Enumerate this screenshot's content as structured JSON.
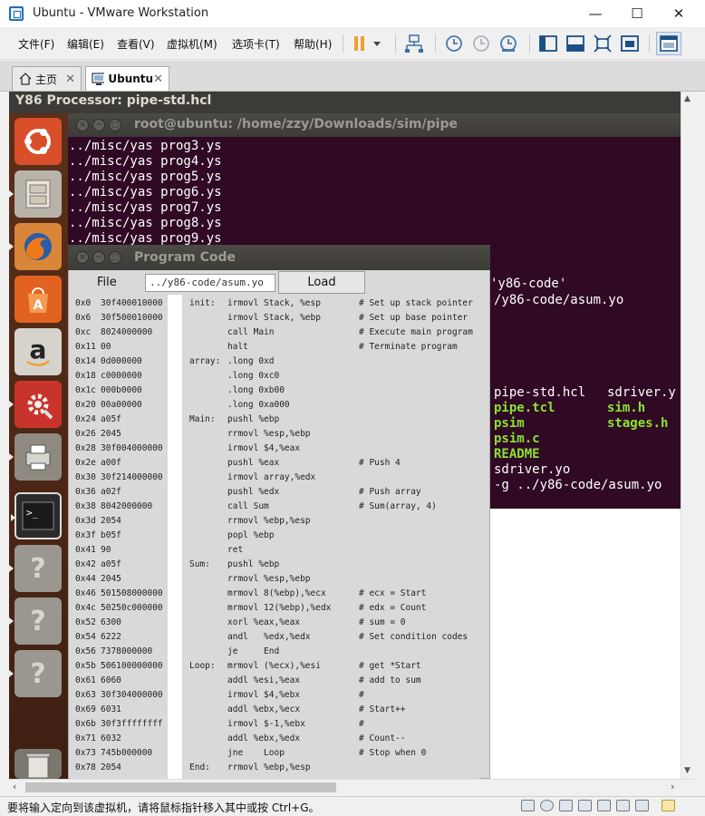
{
  "window": {
    "title": "Ubuntu - VMware Workstation",
    "minimize": "—",
    "maximize": "☐",
    "close": "✕"
  },
  "menu": [
    "文件(F)",
    "编辑(E)",
    "查看(V)",
    "虚拟机(M)",
    "选项卡(T)",
    "帮助(H)"
  ],
  "tabs": [
    {
      "label": "主页",
      "icon": "home-icon"
    },
    {
      "label": "Ubuntu",
      "icon": "vm-icon"
    }
  ],
  "guest": {
    "top_title": "Y86 Processor: pipe-std.hcl",
    "launcher": [
      "ubuntu-dash-icon",
      "files-icon",
      "firefox-icon",
      "software-center-icon",
      "amazon-icon",
      "system-settings-icon",
      "printer-icon",
      "terminal-icon",
      "unknown-app-icon",
      "unknown-app-icon",
      "unknown-app-icon",
      "trash-icon"
    ]
  },
  "terminal": {
    "title": "root@ubuntu: /home/zzy/Downloads/sim/pipe",
    "lines": [
      "../misc/yas prog3.ys",
      "../misc/yas prog4.ys",
      "../misc/yas prog5.ys",
      "../misc/yas prog6.ys",
      "../misc/yas prog7.ys",
      "../misc/yas prog8.ys",
      "../misc/yas prog9.ys"
    ],
    "right_fragments": {
      "r1": "'y86-code'",
      "r2": "/y86-code/asum.yo",
      "r3a": "pipe-std.hcl",
      "r3b": "sdriver.y",
      "r4a": "pipe.tcl",
      "r4b": "sim.h",
      "r5a": "psim",
      "r5b": "stages.h",
      "r6": "psim.c",
      "r7": "README",
      "r8": "sdriver.yo",
      "r9": "-g ../y86-code/asum.yo"
    }
  },
  "program_code": {
    "title": "Program Code",
    "file_label": "File",
    "file_value": "../y86-code/asum.yo",
    "load_label": "Load",
    "rows": [
      {
        "addr": "0x0",
        "code": "30f400010000",
        "label": "init:",
        "instr": "irmovl Stack, %esp",
        "comment": "# Set up stack pointer"
      },
      {
        "addr": "0x6",
        "code": "30f500010000",
        "label": "",
        "instr": "irmovl Stack, %ebp",
        "comment": "# Set up base pointer"
      },
      {
        "addr": "0xc",
        "code": "8024000000",
        "label": "",
        "instr": "call Main",
        "comment": "# Execute main program"
      },
      {
        "addr": "0x11",
        "code": "00",
        "label": "",
        "instr": "halt",
        "comment": "# Terminate program"
      },
      {
        "addr": "0x14",
        "code": "0d000000",
        "label": "array:",
        "instr": ".long 0xd",
        "comment": ""
      },
      {
        "addr": "0x18",
        "code": "c0000000",
        "label": "",
        "instr": ".long 0xc0",
        "comment": ""
      },
      {
        "addr": "0x1c",
        "code": "000b0000",
        "label": "",
        "instr": ".long 0xb00",
        "comment": ""
      },
      {
        "addr": "0x20",
        "code": "00a00000",
        "label": "",
        "instr": ".long 0xa000",
        "comment": ""
      },
      {
        "addr": "0x24",
        "code": "a05f",
        "label": "Main:",
        "instr": "pushl %ebp",
        "comment": ""
      },
      {
        "addr": "0x26",
        "code": "2045",
        "label": "",
        "instr": "rrmovl %esp,%ebp",
        "comment": ""
      },
      {
        "addr": "0x28",
        "code": "30f004000000",
        "label": "",
        "instr": "irmovl $4,%eax",
        "comment": ""
      },
      {
        "addr": "0x2e",
        "code": "a00f",
        "label": "",
        "instr": "pushl %eax",
        "comment": "# Push 4"
      },
      {
        "addr": "0x30",
        "code": "30f214000000",
        "label": "",
        "instr": "irmovl array,%edx",
        "comment": ""
      },
      {
        "addr": "0x36",
        "code": "a02f",
        "label": "",
        "instr": "pushl %edx",
        "comment": "# Push array"
      },
      {
        "addr": "0x38",
        "code": "8042000000",
        "label": "",
        "instr": "call Sum",
        "comment": "# Sum(array, 4)"
      },
      {
        "addr": "0x3d",
        "code": "2054",
        "label": "",
        "instr": "rrmovl %ebp,%esp",
        "comment": ""
      },
      {
        "addr": "0x3f",
        "code": "b05f",
        "label": "",
        "instr": "popl %ebp",
        "comment": ""
      },
      {
        "addr": "0x41",
        "code": "90",
        "label": "",
        "instr": "ret",
        "comment": ""
      },
      {
        "addr": "0x42",
        "code": "a05f",
        "label": "Sum:",
        "instr": "pushl %ebp",
        "comment": ""
      },
      {
        "addr": "0x44",
        "code": "2045",
        "label": "",
        "instr": "rrmovl %esp,%ebp",
        "comment": ""
      },
      {
        "addr": "0x46",
        "code": "501508000000",
        "label": "",
        "instr": "mrmovl 8(%ebp),%ecx",
        "comment": "# ecx = Start"
      },
      {
        "addr": "0x4c",
        "code": "50250c000000",
        "label": "",
        "instr": "mrmovl 12(%ebp),%edx",
        "comment": "# edx = Count"
      },
      {
        "addr": "0x52",
        "code": "6300",
        "label": "",
        "instr": "xorl %eax,%eax",
        "comment": "# sum = 0"
      },
      {
        "addr": "0x54",
        "code": "6222",
        "label": "",
        "instr": "andl   %edx,%edx",
        "comment": "# Set condition codes"
      },
      {
        "addr": "0x56",
        "code": "7378000000",
        "label": "",
        "instr": "je     End",
        "comment": ""
      },
      {
        "addr": "0x5b",
        "code": "506100000000",
        "label": "Loop:",
        "instr": "mrmovl (%ecx),%esi",
        "comment": "# get *Start"
      },
      {
        "addr": "0x61",
        "code": "6060",
        "label": "",
        "instr": "addl %esi,%eax",
        "comment": "# add to sum"
      },
      {
        "addr": "0x63",
        "code": "30f304000000",
        "label": "",
        "instr": "irmovl $4,%ebx",
        "comment": "#"
      },
      {
        "addr": "0x69",
        "code": "6031",
        "label": "",
        "instr": "addl %ebx,%ecx",
        "comment": "# Start++"
      },
      {
        "addr": "0x6b",
        "code": "30f3ffffffff",
        "label": "",
        "instr": "irmovl $-1,%ebx",
        "comment": "#"
      },
      {
        "addr": "0x71",
        "code": "6032",
        "label": "",
        "instr": "addl %ebx,%edx",
        "comment": "# Count--"
      },
      {
        "addr": "0x73",
        "code": "745b000000",
        "label": "",
        "instr": "jne    Loop",
        "comment": "# Stop when 0"
      },
      {
        "addr": "0x78",
        "code": "2054",
        "label": "End:",
        "instr": "rrmovl %ebp,%esp",
        "comment": ""
      }
    ]
  },
  "status": {
    "text": "要将输入定向到该虚拟机，请将鼠标指针移入其中或按 Ctrl+G。"
  },
  "colors": {
    "terminal_bg": "#300a24",
    "launcher_bg": "#4b2615",
    "ubuntu_panel": "#3c3b37",
    "pause_icon": "#f0a030"
  }
}
